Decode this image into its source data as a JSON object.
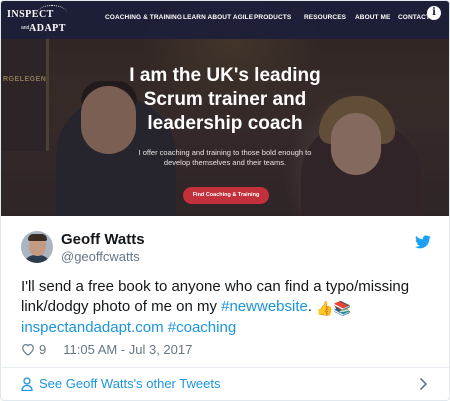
{
  "website": {
    "logo_top": "INSPECT",
    "logo_and": "and",
    "logo_bottom": "ADAPT",
    "nav": [
      "COACHING & TRAINING",
      "LEARN ABOUT AGILE",
      "PRODUCTS",
      "RESOURCES",
      "ABOUT ME",
      "CONTACT"
    ],
    "info_icon": "info-icon",
    "board_text": "RGELEGEN",
    "headline_line1": "I am the UK's leading",
    "headline_line2": "Scrum trainer and",
    "headline_line3": "leadership coach",
    "subtext_line1": "I offer coaching and training to those bold enough to",
    "subtext_line2": "develop themselves and their teams.",
    "cta": "Find Coaching & Training",
    "colors": {
      "navbar": "#1c1e3a",
      "cta": "#c2303c"
    }
  },
  "tweet": {
    "author_name": "Geoff Watts",
    "author_handle": "@geoffcwatts",
    "text_part1": "I'll send a free book to anyone who can find a typo/missing link/dodgy photo of me on my ",
    "hashtag1": "#newwebsite",
    "text_part2": ". ",
    "emojis": [
      "thumbs-up",
      "books"
    ],
    "link": "inspectandadapt.com",
    "hashtag2": "#coaching",
    "likes": "9",
    "timestamp": "11:05 AM - Jul 3, 2017",
    "footer_link": "See Geoff Watts's other Tweets",
    "colors": {
      "link": "#1b95e0",
      "muted": "#657786"
    }
  }
}
